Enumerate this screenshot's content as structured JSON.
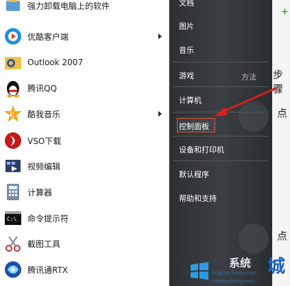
{
  "programs": [
    {
      "label": "强力卸载电脑上的软件",
      "icon": "uninstall-icon",
      "arrow": false
    },
    {
      "label": "优酷客户端",
      "icon": "youku-icon",
      "arrow": true
    },
    {
      "label": "Outlook 2007",
      "icon": "outlook-icon",
      "arrow": false
    },
    {
      "label": "腾讯QQ",
      "icon": "qq-penguin-icon",
      "arrow": false
    },
    {
      "label": "酷我音乐",
      "icon": "kuwo-icon",
      "arrow": true
    },
    {
      "label": "VSO下载",
      "icon": "vso-icon",
      "arrow": false
    },
    {
      "label": "视频编辑",
      "icon": "video-edit-icon",
      "arrow": false
    },
    {
      "label": "计算器",
      "icon": "calculator-icon",
      "arrow": false
    },
    {
      "label": "命令提示符",
      "icon": "cmd-icon",
      "arrow": false
    },
    {
      "label": "截图工具",
      "icon": "scissors-icon",
      "arrow": false
    },
    {
      "label": "腾讯通RTX",
      "icon": "rtx-icon",
      "arrow": false
    }
  ],
  "right_menu": [
    {
      "label": "文档"
    },
    {
      "label": "图片"
    },
    {
      "label": "音乐"
    },
    {
      "label": "游戏"
    },
    {
      "label": "计算机"
    },
    {
      "label": "控制面板"
    },
    {
      "label": "设备和打印机"
    },
    {
      "label": "默认程序"
    },
    {
      "label": "帮助和支持"
    }
  ],
  "background": {
    "plus": "+",
    "step_text": "步骤",
    "click_text_1": "点",
    "click_text_2": "点",
    "faint_label": "方法"
  },
  "watermark": {
    "url_top": "jingyan.baidu.com",
    "url_bottom": "xitongcheng.com",
    "big_char": "城",
    "brand": "系统"
  },
  "colors": {
    "menu_dark": "#33373a",
    "highlight_border": "#e05040",
    "arrow_red": "#d42020",
    "watermark_blue": "#1e63c7"
  }
}
